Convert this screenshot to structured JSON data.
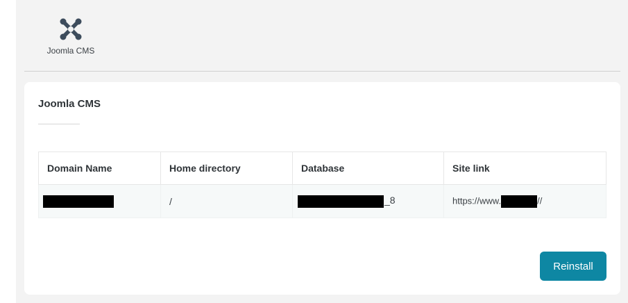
{
  "app_tile": {
    "label": "Joomla CMS",
    "icon": "joomla-logo-icon"
  },
  "card": {
    "title": "Joomla CMS"
  },
  "table": {
    "headers": [
      "Domain Name",
      "Home directory",
      "Database",
      "Site link"
    ],
    "rows": [
      {
        "home_directory": "/",
        "database_suffix": "_8",
        "site_prefix": "https://www.",
        "site_suffix": "//"
      }
    ]
  },
  "actions": {
    "reinstall_label": "Reinstall"
  },
  "colors": {
    "accent": "#0e87a3",
    "icon": "#3d4c5c"
  }
}
